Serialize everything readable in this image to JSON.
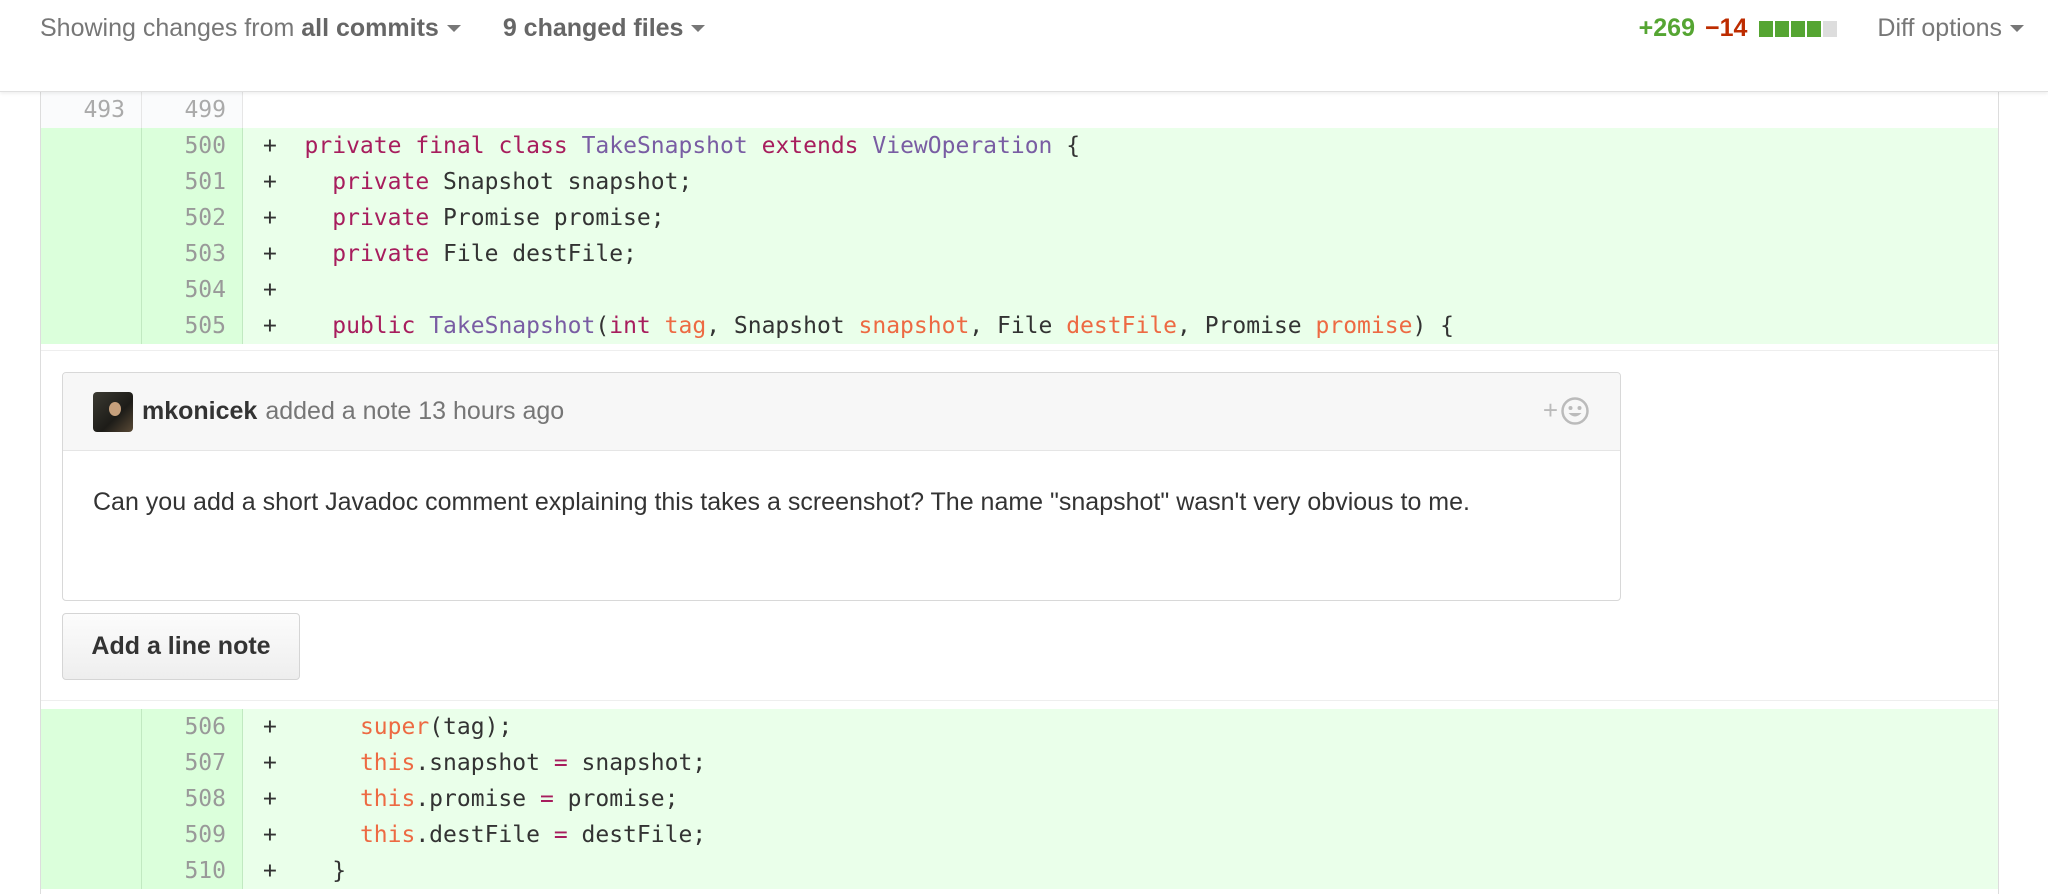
{
  "toolbar": {
    "showing_prefix": "Showing changes from ",
    "commits_label": "all commits",
    "files_label": "9 changed files",
    "additions": "+269",
    "deletions": "−14",
    "diffstat": {
      "added_blocks": 4,
      "neutral_blocks": 1
    },
    "diff_options": "Diff options"
  },
  "colors": {
    "added_bg": "#eaffea",
    "added_gutter": "#dbffdb",
    "additions_text": "#55a532",
    "deletions_text": "#bd2c00",
    "keyword": "#a71d5d",
    "type": "#795da3",
    "param": "#ed6a43"
  },
  "diff_top": [
    {
      "old": "493",
      "new": "499",
      "kind": "ctx",
      "tokens": []
    },
    {
      "old": "",
      "new": "500",
      "kind": "add",
      "tokens": [
        [
          "+  ",
          ""
        ],
        [
          "private",
          "kw"
        ],
        [
          " ",
          ""
        ],
        [
          "final",
          "kw"
        ],
        [
          " ",
          ""
        ],
        [
          "class",
          "kw"
        ],
        [
          " ",
          ""
        ],
        [
          "TakeSnapshot",
          "ty"
        ],
        [
          " ",
          ""
        ],
        [
          "extends",
          "kw"
        ],
        [
          " ",
          ""
        ],
        [
          "ViewOperation",
          "ty"
        ],
        [
          " {",
          ""
        ]
      ]
    },
    {
      "old": "",
      "new": "501",
      "kind": "add",
      "tokens": [
        [
          "+    ",
          ""
        ],
        [
          "private",
          "kw"
        ],
        [
          " Snapshot snapshot;",
          ""
        ]
      ]
    },
    {
      "old": "",
      "new": "502",
      "kind": "add",
      "tokens": [
        [
          "+    ",
          ""
        ],
        [
          "private",
          "kw"
        ],
        [
          " Promise promise;",
          ""
        ]
      ]
    },
    {
      "old": "",
      "new": "503",
      "kind": "add",
      "tokens": [
        [
          "+    ",
          ""
        ],
        [
          "private",
          "kw"
        ],
        [
          " File destFile;",
          ""
        ]
      ]
    },
    {
      "old": "",
      "new": "504",
      "kind": "add",
      "tokens": [
        [
          "+",
          ""
        ]
      ]
    },
    {
      "old": "",
      "new": "505",
      "kind": "add",
      "tokens": [
        [
          "+    ",
          ""
        ],
        [
          "public",
          "kw"
        ],
        [
          " ",
          ""
        ],
        [
          "TakeSnapshot",
          "ty"
        ],
        [
          "(",
          ""
        ],
        [
          "int",
          "kw"
        ],
        [
          " ",
          ""
        ],
        [
          "tag",
          "pa"
        ],
        [
          ", Snapshot ",
          ""
        ],
        [
          "snapshot",
          "pa"
        ],
        [
          ", File ",
          ""
        ],
        [
          "destFile",
          "pa"
        ],
        [
          ", Promise ",
          ""
        ],
        [
          "promise",
          "pa"
        ],
        [
          ") {",
          ""
        ]
      ]
    }
  ],
  "comment": {
    "author": "mkonicek",
    "meta": "added a note 13 hours ago",
    "react_plus": "+",
    "body": "Can you add a short Javadoc comment explaining this takes a screenshot? The name \"snapshot\" wasn't very obvious to me."
  },
  "line_note_button": "Add a line note",
  "diff_bottom": [
    {
      "old": "",
      "new": "506",
      "kind": "add",
      "tokens": [
        [
          "+      ",
          ""
        ],
        [
          "super",
          "pa"
        ],
        [
          "(tag);",
          ""
        ]
      ]
    },
    {
      "old": "",
      "new": "507",
      "kind": "add",
      "tokens": [
        [
          "+      ",
          ""
        ],
        [
          "this",
          "pa"
        ],
        [
          ".snapshot ",
          ""
        ],
        [
          "=",
          "kw"
        ],
        [
          " snapshot;",
          ""
        ]
      ]
    },
    {
      "old": "",
      "new": "508",
      "kind": "add",
      "tokens": [
        [
          "+      ",
          ""
        ],
        [
          "this",
          "pa"
        ],
        [
          ".promise ",
          ""
        ],
        [
          "=",
          "kw"
        ],
        [
          " promise;",
          ""
        ]
      ]
    },
    {
      "old": "",
      "new": "509",
      "kind": "add",
      "tokens": [
        [
          "+      ",
          ""
        ],
        [
          "this",
          "pa"
        ],
        [
          ".destFile ",
          ""
        ],
        [
          "=",
          "kw"
        ],
        [
          " destFile;",
          ""
        ]
      ]
    },
    {
      "old": "",
      "new": "510",
      "kind": "add",
      "tokens": [
        [
          "+    }",
          ""
        ]
      ]
    }
  ]
}
